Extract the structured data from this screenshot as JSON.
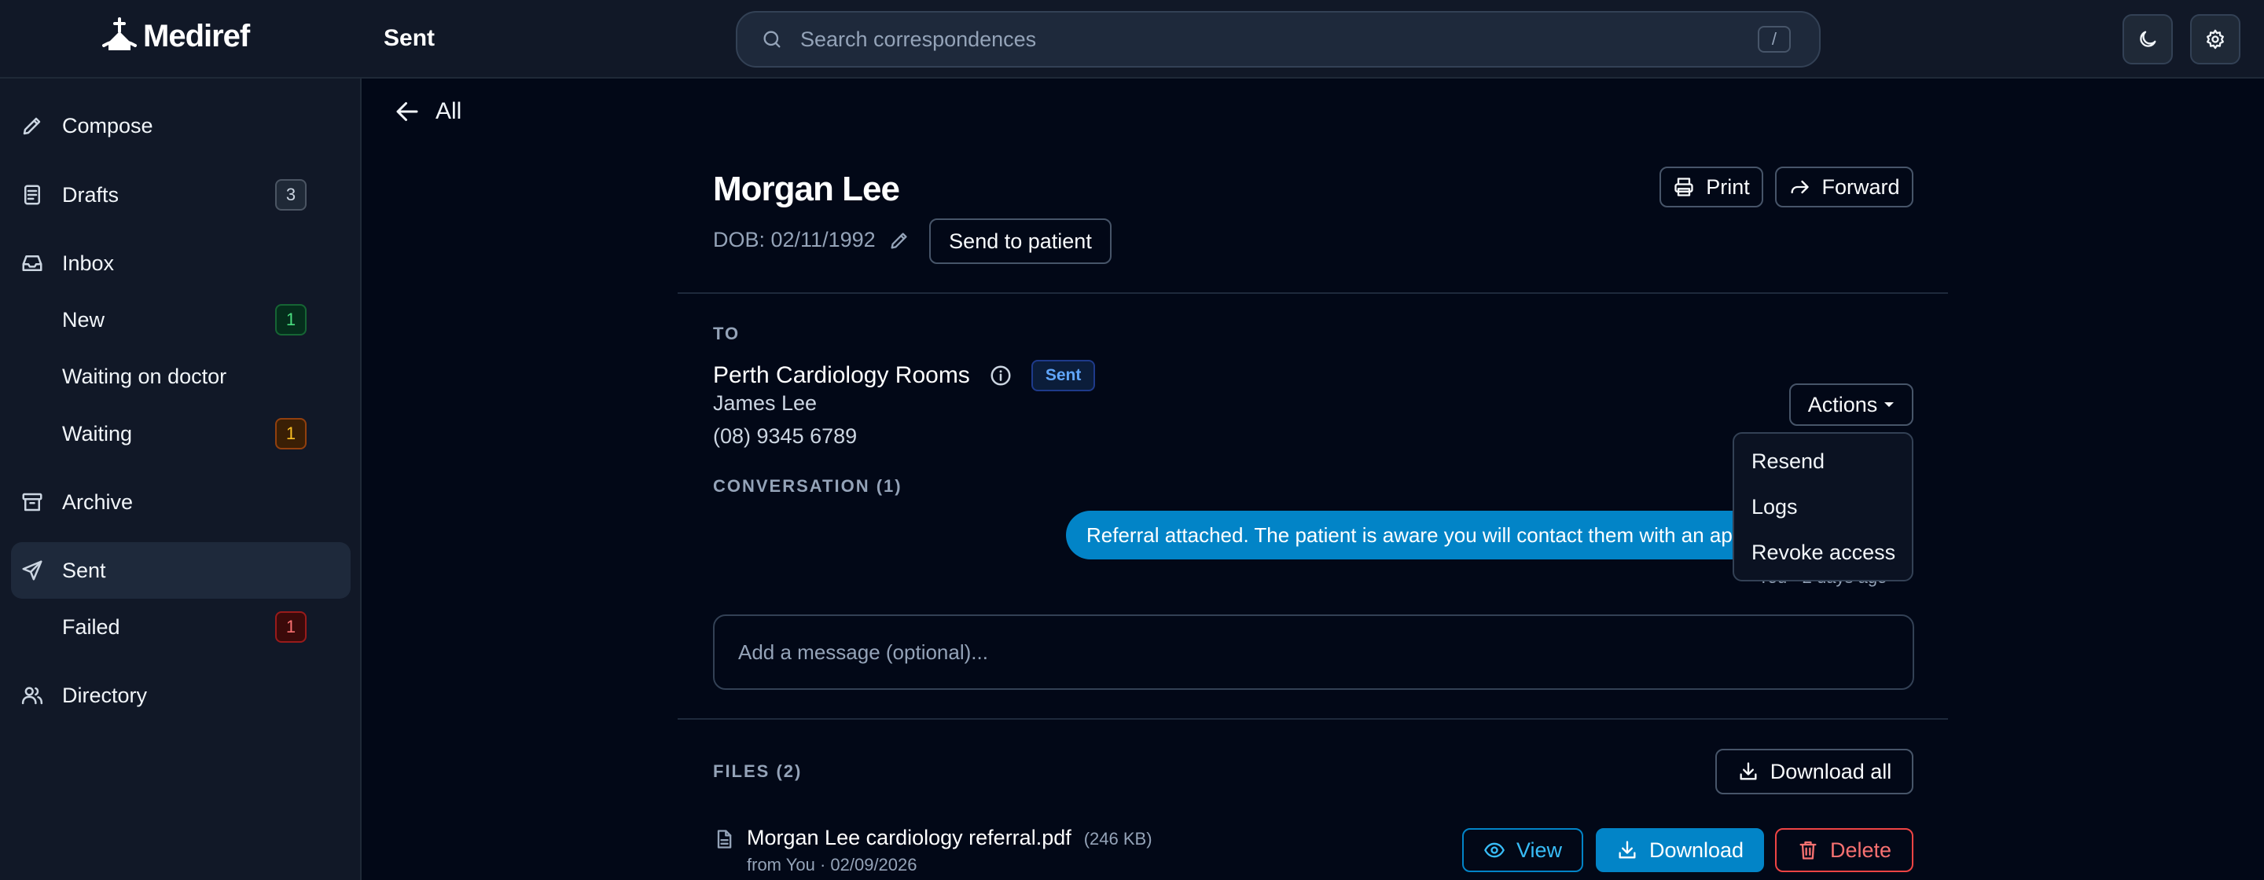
{
  "app": {
    "name": "Mediref",
    "page_title": "Sent"
  },
  "search": {
    "placeholder": "Search correspondences",
    "shortcut": "/"
  },
  "header_buttons": {
    "theme_icon": "moon-icon",
    "settings_icon": "gear-icon"
  },
  "sidebar": {
    "items": [
      {
        "label": "Compose",
        "icon": "pencil-icon"
      },
      {
        "label": "Drafts",
        "icon": "drafts-icon",
        "badge": "3"
      },
      {
        "label": "Inbox",
        "icon": "inbox-icon"
      },
      {
        "label": "New",
        "badge": "1"
      },
      {
        "label": "Waiting on doctor"
      },
      {
        "label": "Waiting",
        "badge": "1"
      },
      {
        "label": "Archive",
        "icon": "archive-icon"
      },
      {
        "label": "Sent",
        "icon": "send-icon",
        "active": true
      },
      {
        "label": "Failed",
        "badge": "1"
      },
      {
        "label": "Directory",
        "icon": "users-icon"
      }
    ]
  },
  "back": {
    "label": "All"
  },
  "patient": {
    "name": "Morgan Lee",
    "dob": "DOB: 02/11/1992"
  },
  "buttons": {
    "print": "Print",
    "forward": "Forward",
    "send_to_patient": "Send to patient",
    "actions": "Actions",
    "download_all": "Download all",
    "view": "View",
    "download": "Download",
    "delete": "Delete"
  },
  "recipient": {
    "section_label": "TO",
    "name": "Perth Cardiology Rooms",
    "status": "Sent",
    "contact": "James Lee",
    "phone": "(08) 9345 6789"
  },
  "conversation": {
    "label": "CONVERSATION (1)",
    "message": "Referral attached. The patient is aware you will contact them with an appointment.",
    "meta": "You · 2 days ago",
    "input_placeholder": "Add a message (optional)..."
  },
  "actions_menu": {
    "items": [
      "Resend",
      "Logs",
      "Revoke access"
    ]
  },
  "files": {
    "label": "FILES (2)",
    "items": [
      {
        "name": "Morgan Lee cardiology referral.pdf",
        "size": "(246 KB)",
        "meta": "from You · 02/09/2026"
      }
    ]
  },
  "colors": {
    "background": "#020817",
    "sidebar": "#111827",
    "accent": "#0284c7",
    "danger": "#ef4444"
  }
}
